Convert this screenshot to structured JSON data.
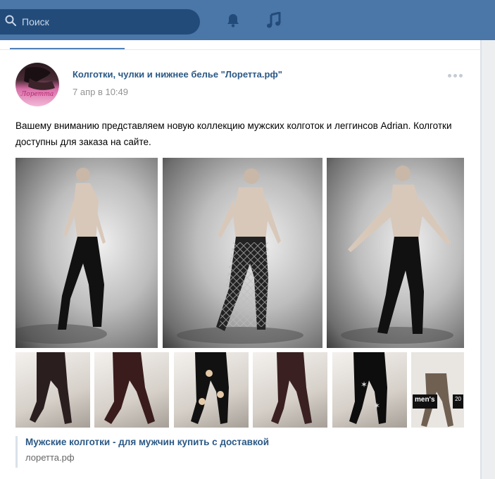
{
  "topbar": {
    "search_placeholder": "Поиск",
    "icons": [
      "search-icon",
      "bell-icon",
      "music-icon"
    ],
    "color": "#4a76a8",
    "search_bg": "#224b7a"
  },
  "post": {
    "author": "Колготки, чулки и нижнее белье \"Лоретта.рф\"",
    "time": "7 апр в 10:49",
    "text": "Вашему вниманию представляем новую коллекцию мужских колготок и леггинсов Adrian. Колготки доступны для заказа на сайте.",
    "avatar_caption": "Лоретта",
    "link": {
      "title": "Мужские колготки - для мужчин купить с доставкой",
      "domain": "лоретта.рф"
    },
    "thumb_badge": {
      "brand": "men's",
      "number": "20"
    },
    "colors": {
      "link": "#2a5885",
      "meta": "#939393",
      "accent": "#5181b8"
    }
  }
}
